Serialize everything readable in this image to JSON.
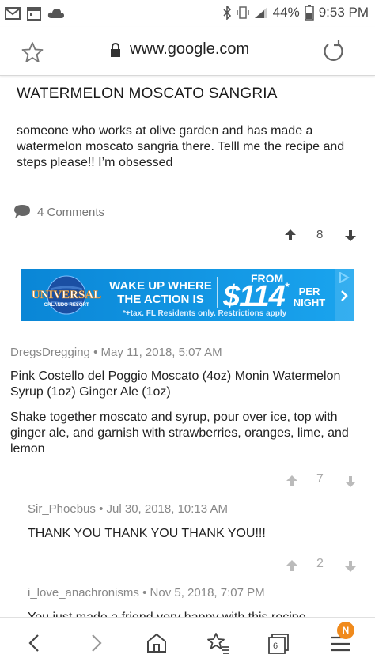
{
  "status_bar": {
    "battery": "44%",
    "time": "9:53 PM",
    "icons": [
      "mail-icon",
      "calendar-icon",
      "cloud-icon",
      "bluetooth-icon",
      "vibrate-icon",
      "signal-icon",
      "battery-icon"
    ]
  },
  "url_bar": {
    "url": "www.google.com",
    "icons": [
      "star-icon",
      "lock-icon",
      "reload-icon"
    ]
  },
  "post": {
    "title": "WATERMELON MOSCATO SANGRIA",
    "body": "someone who works at olive garden and has made a watermelon moscato sangria there. Telll me the recipe and steps please!! I’m obsessed",
    "comments_link": "4 Comments",
    "votes": "8"
  },
  "ad": {
    "brand": "UNIVERSAL",
    "brand_sub": "ORLANDO RESORT",
    "headline_1": "WAKE UP WHERE",
    "headline_2": "THE ACTION IS",
    "from": "FROM",
    "price": "$114",
    "price_note": "*",
    "per": "PER",
    "night": "NIGHT",
    "fine_print": "*+tax. FL Residents only. Restrictions apply"
  },
  "comments": [
    {
      "author": "DregsDregging",
      "date": "May 11, 2018, 5:07 AM",
      "text_1": "Pink Costello del Poggio Moscato (4oz) Monin Watermelon Syrup (1oz) Ginger Ale (1oz)",
      "text_2": "Shake together moscato and syrup, pour over ice, top with ginger ale, and garnish with strawberries, oranges, lime, and lemon",
      "votes": "7"
    },
    {
      "author": "Sir_Phoebus",
      "date": "Jul 30, 2018, 10:13 AM",
      "text": "THANK YOU THANK YOU THANK YOU!!!",
      "votes": "2"
    },
    {
      "author": "i_love_anachronisms",
      "date": "Nov 5, 2018, 7:07 PM",
      "text": "You just made a friend very happy with this recipe"
    }
  ],
  "separator": "•",
  "bottom_nav": {
    "tab_count": "6",
    "badge": "N"
  },
  "colors": {
    "ad_blue": "#1aa4ee",
    "badge_orange": "#f08a1c",
    "meta_gray": "#888888"
  }
}
